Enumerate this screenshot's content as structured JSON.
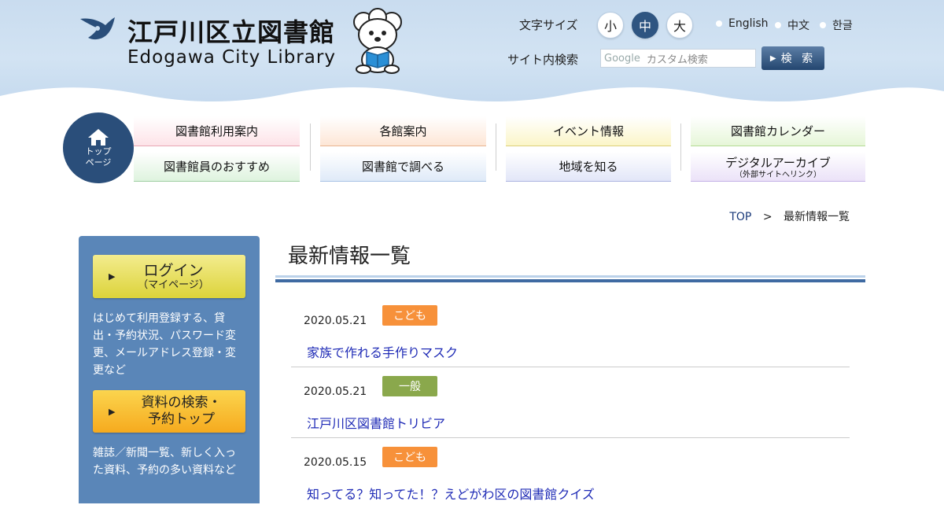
{
  "header": {
    "title_ja": "江戸川区立図書館",
    "title_en": "Edogawa City Library",
    "font_size_label": "文字サイズ",
    "font_sizes": [
      {
        "label": "小",
        "active": false
      },
      {
        "label": "中",
        "active": true
      },
      {
        "label": "大",
        "active": false
      }
    ],
    "languages": [
      "English",
      "中文",
      "한글"
    ],
    "search_label": "サイト内検索",
    "search_brand": "Google",
    "search_placeholder": "カスタム検索",
    "search_button": "検 索"
  },
  "nav": {
    "home_line1": "トップ",
    "home_line2": "ページ",
    "items": [
      {
        "label": "図書館利用案内",
        "color": "#fde3e8"
      },
      {
        "label": "図書館員のおすすめ",
        "color": "#def3de"
      },
      {
        "label": "各館案内",
        "color": "#fde6d6"
      },
      {
        "label": "図書館で調べる",
        "color": "#dfeaf8"
      },
      {
        "label": "イベント情報",
        "color": "#fbf5c8"
      },
      {
        "label": "地域を知る",
        "color": "#e2e6f8"
      },
      {
        "label": "図書館カレンダー",
        "color": "#e6f6d8"
      },
      {
        "label": "デジタルアーカイブ",
        "sub": "（外部サイトへリンク）",
        "color": "#ebe2f8"
      }
    ]
  },
  "breadcrumb": {
    "top": "TOP",
    "separator": ">",
    "current": "最新情報一覧"
  },
  "sidebar": {
    "login_label": "ログイン",
    "login_sub": "（マイページ）",
    "login_desc": "はじめて利用登録する、貸出・予約状況、パスワード変更、メールアドレス登録・変更など",
    "search_label_line1": "資料の検索・",
    "search_label_line2": "予約トップ",
    "search_desc": "雑誌／新聞一覧、新しく入った資料、予約の多い資料など"
  },
  "main": {
    "title": "最新情報一覧",
    "news": [
      {
        "date": "2020.05.21",
        "tag": "こども",
        "tag_color": "#f7913a",
        "title": "家族で作れる手作りマスク"
      },
      {
        "date": "2020.05.21",
        "tag": "一般",
        "tag_color": "#8aa84c",
        "title": "江戸川区図書館トリビア"
      },
      {
        "date": "2020.05.15",
        "tag": "こども",
        "tag_color": "#f7913a",
        "title": "知ってる？知ってた！？えどがわ区の図書館クイズ"
      }
    ]
  }
}
